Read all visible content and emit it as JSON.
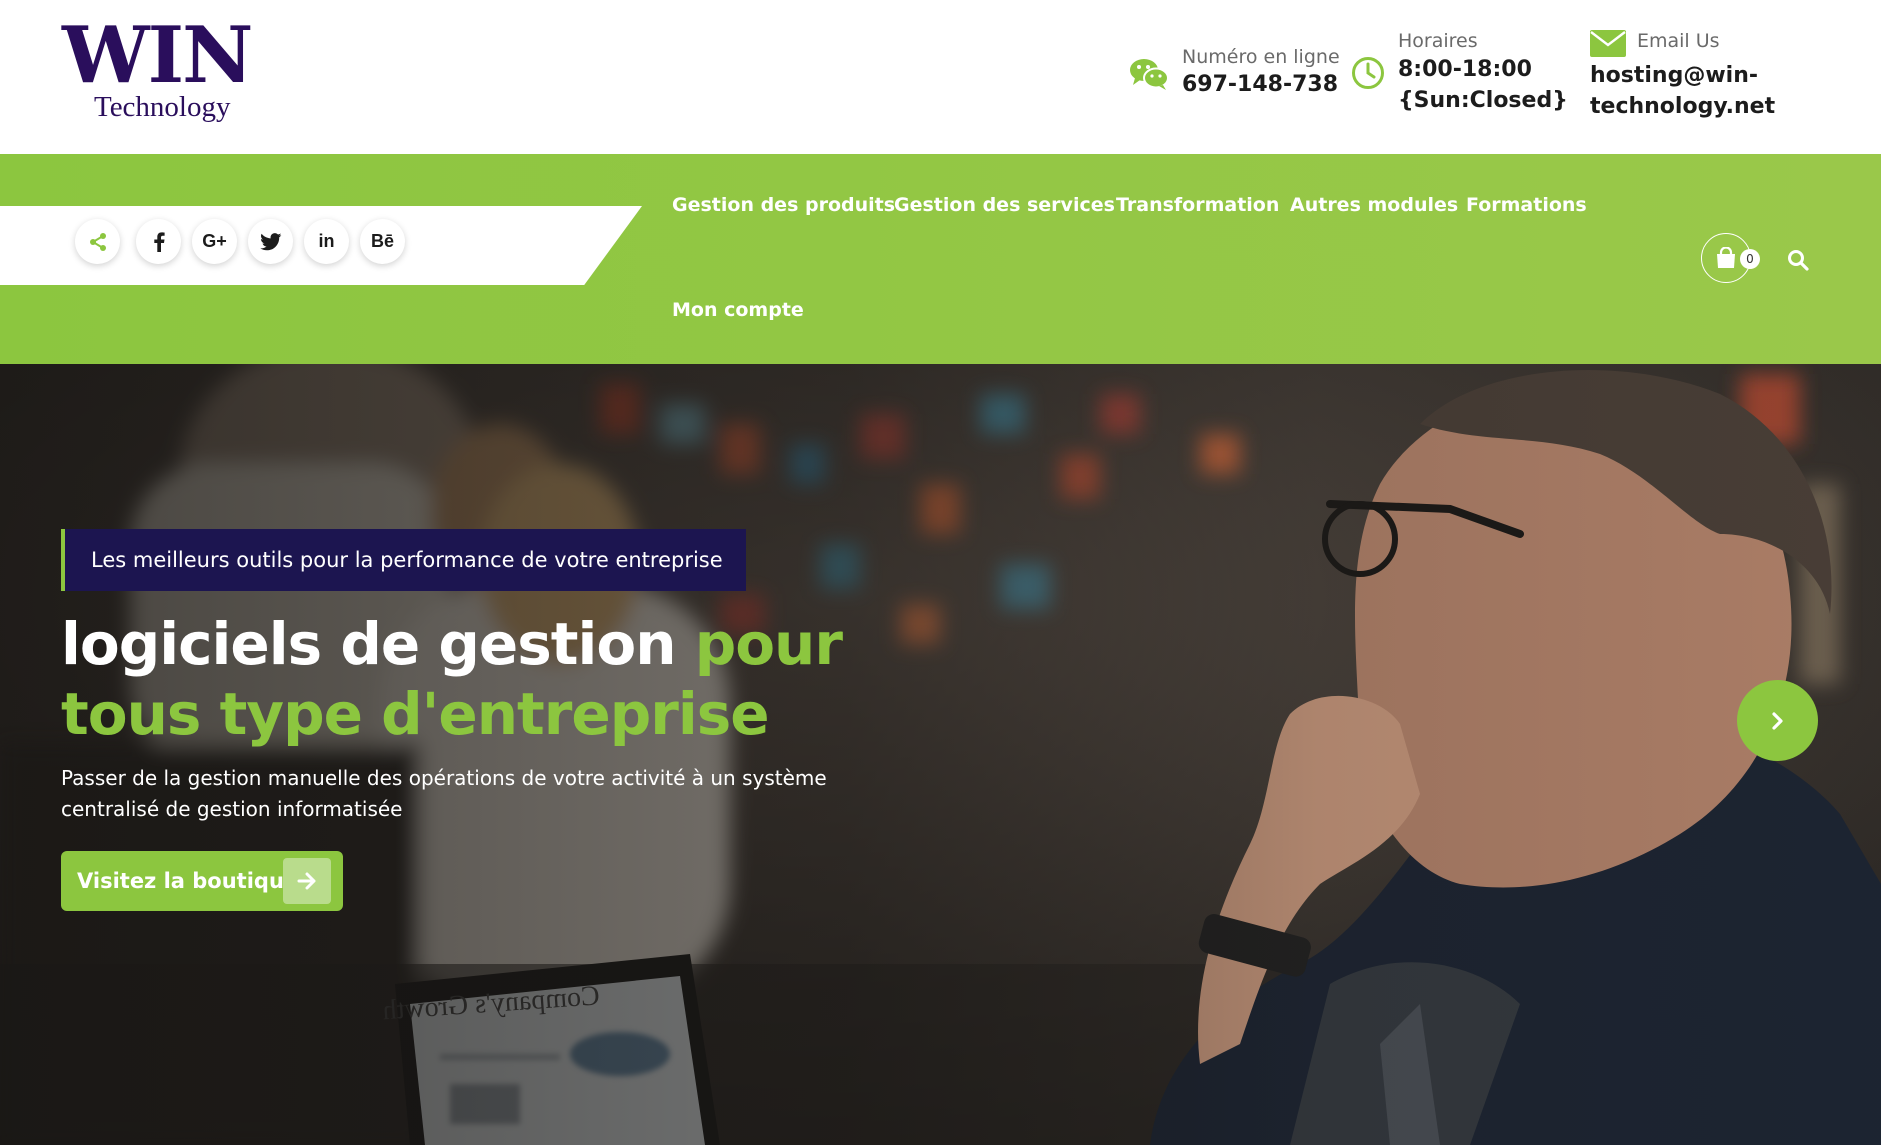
{
  "brand": {
    "logo_main": "WIN",
    "logo_sub": "Technology"
  },
  "header": {
    "phone": {
      "label": "Numéro en ligne",
      "value": "697-148-738"
    },
    "hours": {
      "label": "Horaires",
      "line1": "8:00-18:00",
      "line2": "{Sun:Closed}"
    },
    "email": {
      "label": "Email Us",
      "line1": "hosting@win-",
      "line2": "technology.net"
    }
  },
  "social": [
    {
      "icon": "share-icon",
      "glyph": "share"
    },
    {
      "icon": "facebook-icon",
      "glyph": "f"
    },
    {
      "icon": "google-plus-icon",
      "glyph": "G+"
    },
    {
      "icon": "twitter-icon",
      "glyph": "twitter"
    },
    {
      "icon": "linkedin-icon",
      "glyph": "in"
    },
    {
      "icon": "behance-icon",
      "glyph": "Bē"
    }
  ],
  "nav": {
    "items": [
      "Gestion des produits",
      "Gestion des services",
      "Transformation",
      "Autres modules",
      "Formations",
      "Mon compte"
    ],
    "cart_count": "0"
  },
  "hero": {
    "tagline": "Les meilleurs outils pour la performance de votre entreprise",
    "headline_white": "logiciels de gestion ",
    "headline_green": "pour tous type d'entreprise",
    "description": "Passer de la gestion manuelle des opérations de votre activité à un système centralisé de gestion informatisée",
    "cta_label": "Visitez la boutique",
    "laptop_text": "Company's Growth"
  },
  "colors": {
    "accent_green": "#8cc63f",
    "brand_purple": "#2a0e5c",
    "tagline_bg": "#1c1550"
  }
}
